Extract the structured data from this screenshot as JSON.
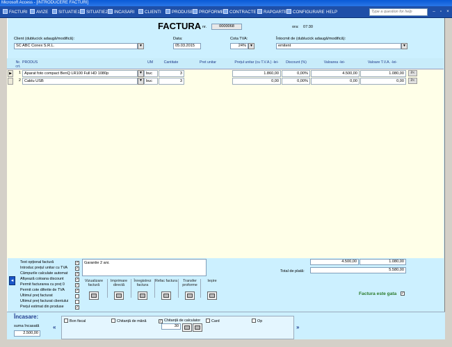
{
  "window": {
    "title": "Microsoft Access - [INTRODUCERE FACTURI]"
  },
  "menu": {
    "items": [
      "FACTURI",
      "AVIZE",
      "SITUATIE1",
      "SITUATIE2",
      "INCASARI",
      "CLIENTI",
      "PRODUSE",
      "PROFORME",
      "CONTRACTE",
      "RAPOARTE",
      "CONFIGURARE",
      "HELP"
    ],
    "help_placeholder": "Type a question for help"
  },
  "header": {
    "title": "FACTURA",
    "nr_label": "nr.",
    "nr_value": "0000068",
    "ora_label": "ora:",
    "ora_value": "07:30",
    "client_label": "Client (dublucick adaugă/modifică):",
    "client_value": "SC ABC Conex S.R.L.",
    "data_label": "Data:",
    "data_value": "05.03.2015",
    "cota_label": "Cota TVA:",
    "cota_value": "24%",
    "intocmit_label": "Întocmit de (dublucick adaugă/modifică):",
    "intocmit_value": "emitent"
  },
  "grid": {
    "headers": {
      "nr": "Nr. crt.",
      "produs": "PRODUS",
      "um": "UM",
      "cantitate": "Cantitate",
      "pret_unitar": "Pret unitar",
      "pret_tva": "Prețul unitar (cu T.V.A.) -lei-",
      "discount": "Discount (%)",
      "valoarea": "Valoarea -lei-",
      "valoare_tva": "Valoare T.V.A. -lei-"
    },
    "rows": [
      {
        "nr": "1",
        "produs": "Aparat foto compact BenQ LR100 Full HD 1080p",
        "um": "buc",
        "cantitate": "3",
        "pret_tva": "1.860,00",
        "discount": "0,00%",
        "valoarea": "4.500,00",
        "valoare_tva": "1.080,00"
      },
      {
        "nr": "2",
        "produs": "Cablu USB",
        "um": "buc",
        "cantitate": "3",
        "pret_tva": "0,00",
        "discount": "0,00%",
        "valoarea": "0,00",
        "valoare_tva": "0,00"
      }
    ]
  },
  "options": [
    {
      "label": "Text opțional factură",
      "checked": true
    },
    {
      "label": "Introduc prețul unitar cu TVA",
      "checked": true
    },
    {
      "label": "Câmpurile calculate automat",
      "checked": true
    },
    {
      "label": "Afișează coloana discount",
      "checked": true
    },
    {
      "label": "Permit facturarea cu preț 0",
      "checked": true
    },
    {
      "label": "Permit cote diferite de TVA",
      "checked": true
    },
    {
      "label": "Ultimul preț facturat",
      "checked": false
    },
    {
      "label": "Ultimul preț facturat clientului",
      "checked": false
    },
    {
      "label": "Prețul estimat din produse",
      "checked": true
    }
  ],
  "notes_text": "Garantie 2 ani.",
  "actions": [
    {
      "label": "Vizualizare factură",
      "icon": "magnifier-icon"
    },
    {
      "label": "Imprimare directă",
      "icon": "printer-icon"
    },
    {
      "label": "Înregistrez factura",
      "icon": "register-icon"
    },
    {
      "label": "Refac factura",
      "icon": "redo-icon"
    },
    {
      "label": "Transfer proforme",
      "icon": "transfer-icon"
    },
    {
      "label": "Ieșire",
      "icon": "exit-icon"
    }
  ],
  "totals": {
    "valoarea": "4.500,00",
    "tva": "1.080,00",
    "total_label": "Total de plată:",
    "total_value": "5.580,00",
    "ready_label": "Factura este gata",
    "ready_checked": true
  },
  "incasare": {
    "title": "Încasare:",
    "suma_label": "suma încasată",
    "suma_value": "2.500,00",
    "types": [
      {
        "label": "Bon fiscal",
        "checked": false
      },
      {
        "label": "Chitanță de mână",
        "checked": false
      },
      {
        "label": "Chitanță de calculator",
        "checked": true
      },
      {
        "label": "Card",
        "checked": false
      },
      {
        "label": "Op",
        "checked": false
      }
    ],
    "receipt_nr": "30"
  },
  "colors": {
    "menubar": "#1e4fa8",
    "form": "#ccf0ff",
    "grid": "#ffffe8",
    "ready": "#2a7a2a"
  }
}
